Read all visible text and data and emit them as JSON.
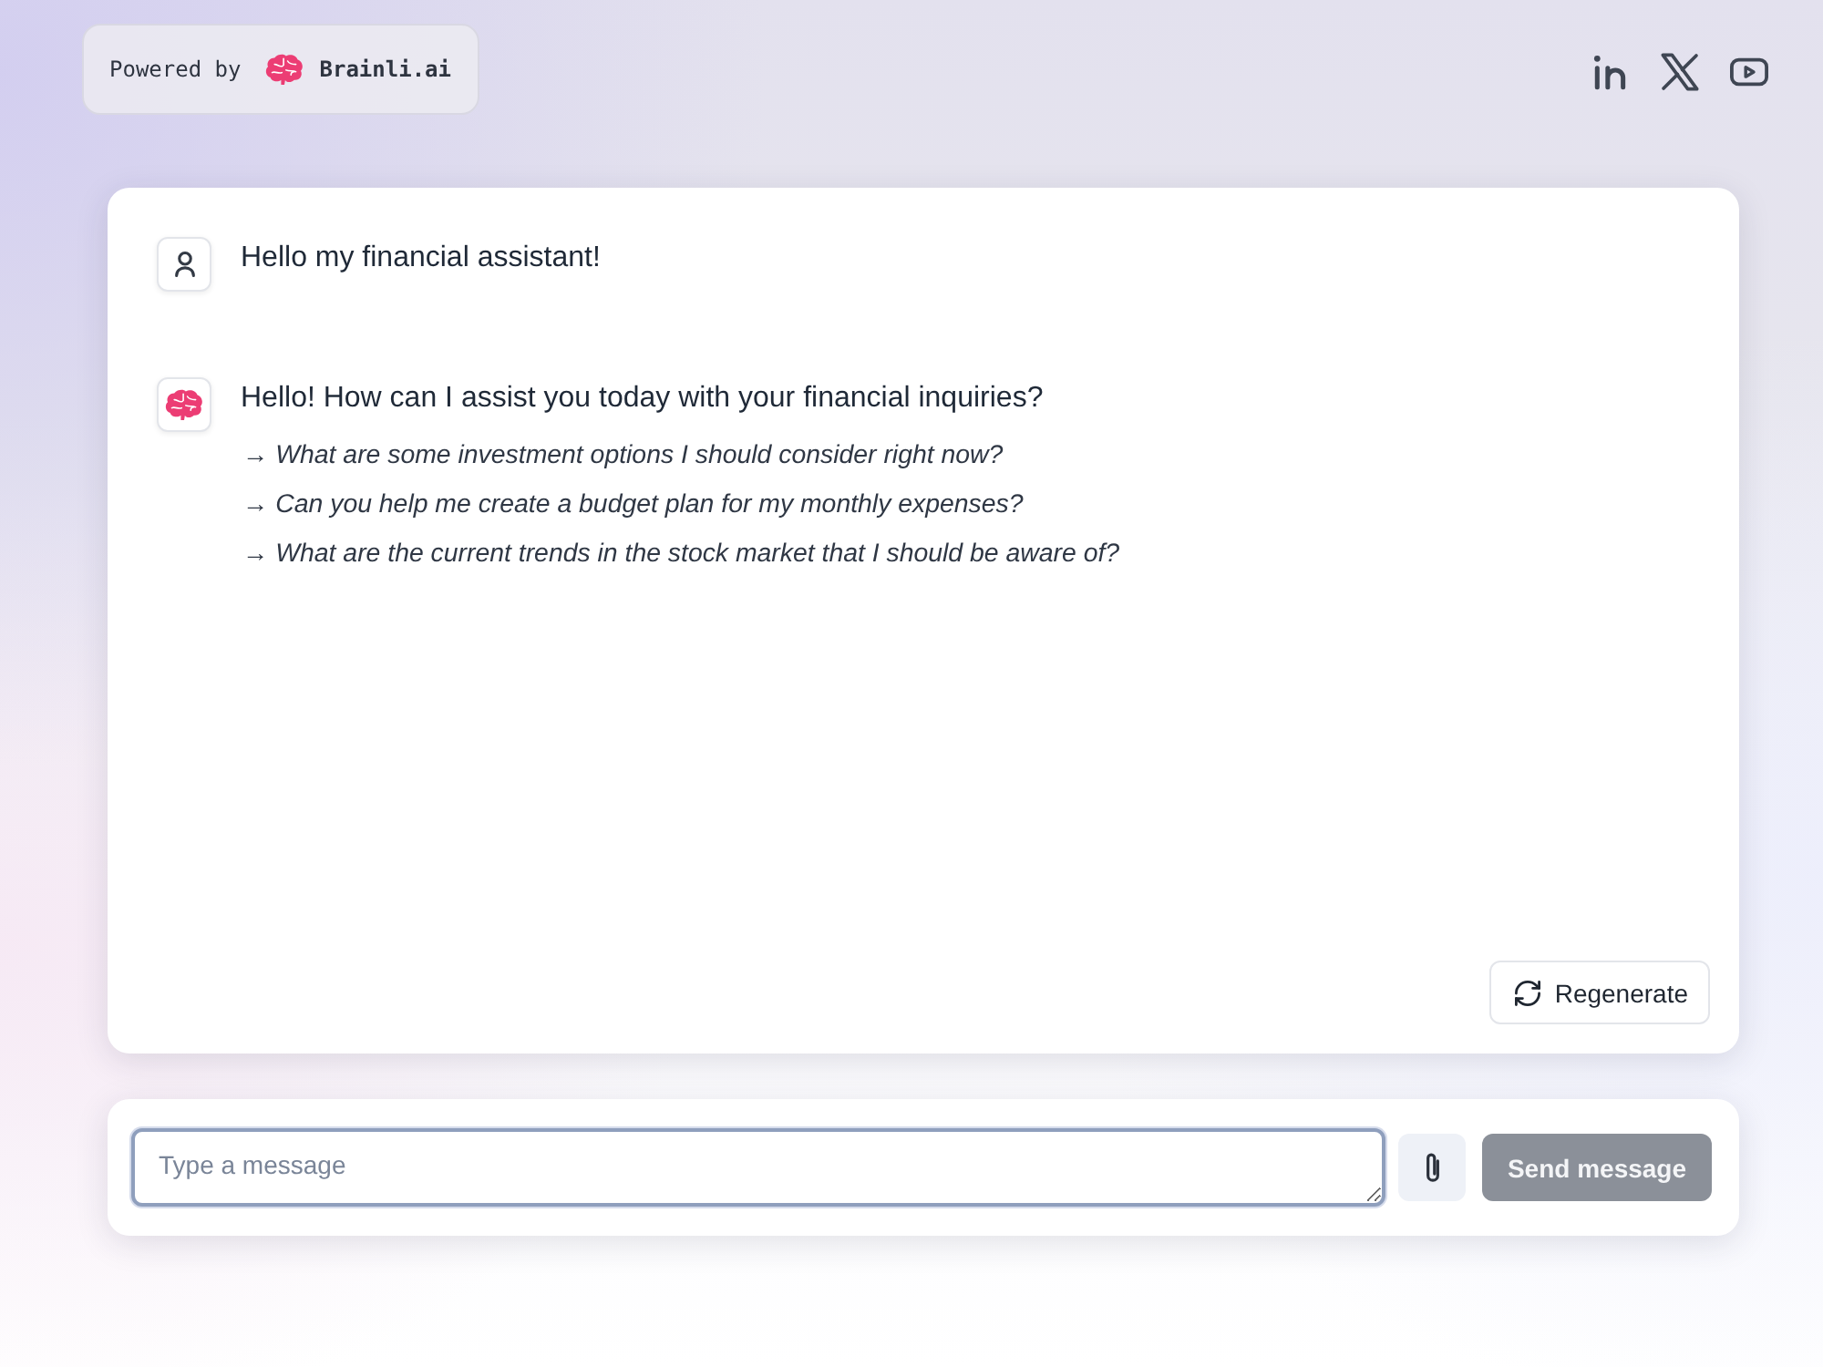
{
  "header": {
    "powered_by": {
      "label": "Powered by",
      "brand": "Brainli.ai"
    },
    "social_links": [
      {
        "kind": "linkedin"
      },
      {
        "kind": "x"
      },
      {
        "kind": "youtube"
      }
    ]
  },
  "chat": {
    "messages": [
      {
        "kind": "user",
        "text": "Hello my financial assistant!"
      },
      {
        "kind": "assistant",
        "text": "Hello! How can I assist you today with your financial inquiries?",
        "suggestions": [
          "→ What are some investment options I should consider right now?",
          "→ Can you help me create a budget plan for my monthly expenses?",
          "→ What are the current trends in the stock market that I should be aware of?"
        ]
      }
    ],
    "regenerate_button": "Regenerate"
  },
  "composer": {
    "placeholder": "Type a message",
    "focused": true,
    "send_button": {
      "label": "Send message",
      "disabled": true
    }
  }
}
